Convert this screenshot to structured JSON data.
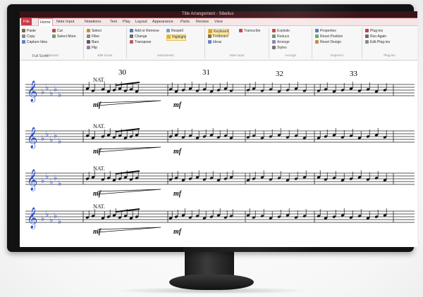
{
  "app": {
    "title": "Title Arrangement - Sibelius",
    "accent": "#c93b45",
    "titlebar_color": "#3a1418"
  },
  "menubar": {
    "items": [
      "File",
      "Home",
      "Note Input",
      "Notations",
      "Text",
      "Play",
      "Layout",
      "Appearance",
      "Parts",
      "Review",
      "View"
    ],
    "active": "Home"
  },
  "ribbon": {
    "groups": [
      {
        "label": "Clipboard",
        "items": [
          "Paste",
          "Copy",
          "Capture Idea",
          "Cut",
          "Select More"
        ]
      },
      {
        "label": "Edit Score",
        "items": [
          "Select",
          "Filter",
          "Bars",
          "Flip"
        ]
      },
      {
        "label": "Instruments",
        "items": [
          "Add or Remove",
          "Change",
          "Transpose",
          "Respell",
          "Highlight"
        ]
      },
      {
        "label": "Note Input",
        "items": [
          "Keyboard",
          "Fretboard",
          "Ideas",
          "Transcribe"
        ]
      },
      {
        "label": "Arrange",
        "items": [
          "Explode",
          "Reduce",
          "Arrange",
          "Styles"
        ]
      },
      {
        "label": "Inspector",
        "items": [
          "Properties",
          "Reset Position",
          "Reset Design"
        ]
      },
      {
        "label": "Plug-ins",
        "items": [
          "Plug-ins",
          "Run Again",
          "Edit Plug-ins"
        ]
      }
    ],
    "status_left": "Full Score"
  },
  "score": {
    "measure_numbers": [
      "30",
      "31",
      "32",
      "33"
    ],
    "annotations": {
      "nat_label": "NAT.",
      "dynamic": "mf"
    },
    "staves": [
      {
        "clef": "treble",
        "key_flats": 5
      },
      {
        "clef": "treble",
        "key_flats": 5
      },
      {
        "clef": "treble",
        "key_flats": 5
      },
      {
        "clef": "treble",
        "key_flats": 5
      }
    ]
  }
}
